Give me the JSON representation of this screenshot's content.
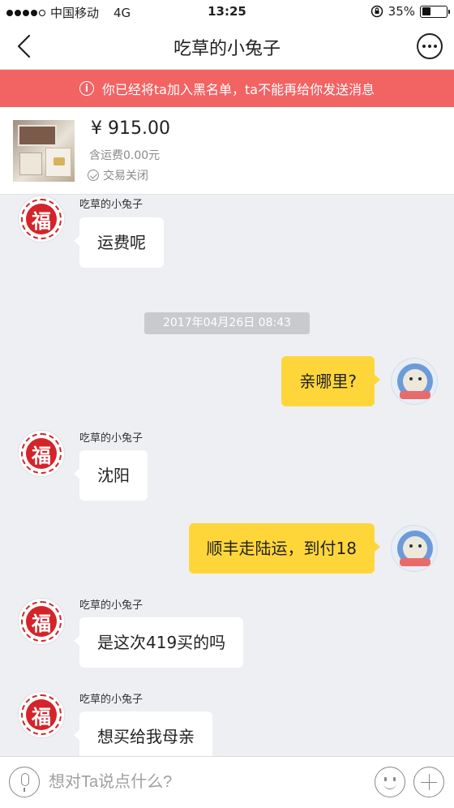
{
  "status_bar": {
    "carrier": "中国移动",
    "network": "4G",
    "time": "13:25",
    "battery": "35%",
    "battery_level": 0.35
  },
  "header": {
    "title": "吃草的小兔子",
    "back_icon": "chevron-left-icon",
    "more_icon": "more-icon"
  },
  "banner": {
    "text": "你已经将ta加入黑名单，ta不能再给你发送消息",
    "bg_color": "#f26364"
  },
  "product": {
    "price": "¥ 915.00",
    "shipping": "含运费0.00元",
    "status": "交易关闭"
  },
  "messages": [
    {
      "from": "them",
      "sender": "吃草的小兔子",
      "text": "运费呢"
    },
    {
      "timestamp": "2017年04月26日  08:43"
    },
    {
      "from": "me",
      "text": "亲哪里?"
    },
    {
      "from": "them",
      "sender": "吃草的小兔子",
      "text": "沈阳"
    },
    {
      "from": "me",
      "text": "顺丰走陆运，到付18"
    },
    {
      "from": "them",
      "sender": "吃草的小兔子",
      "text": "是这次419买的吗"
    },
    {
      "from": "them",
      "sender": "吃草的小兔子",
      "text": "想买给我母亲"
    }
  ],
  "avatar_fu_char": "福",
  "input": {
    "placeholder": "想对Ta说点什么?"
  },
  "colors": {
    "outgoing_bubble": "#ffd63a",
    "incoming_bubble": "#ffffff",
    "chat_bg": "#eeeff3"
  }
}
